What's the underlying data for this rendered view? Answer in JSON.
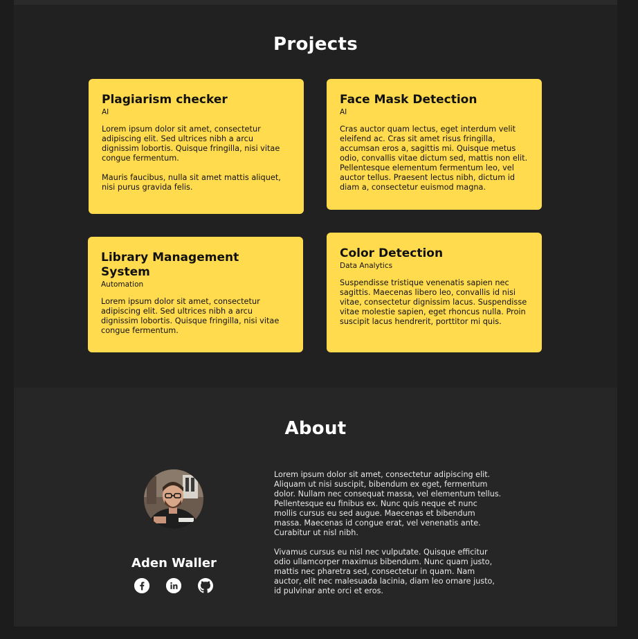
{
  "projects": {
    "title": "Projects",
    "cards": [
      {
        "title": "Plagiarism checker",
        "tag": "AI",
        "desc": "Lorem ipsum dolor sit amet, consectetur adipiscing elit. Sed ultrices nibh a arcu dignissim lobortis. Quisque fringilla, nisi vitae congue fermentum.\n\nMauris faucibus, nulla sit amet mattis aliquet, nisi purus gravida felis."
      },
      {
        "title": "Face Mask Detection",
        "tag": "AI",
        "desc": "Cras auctor quam lectus, eget interdum velit eleifend ac. Cras sit amet risus fringilla, accumsan eros a, sagittis mi. Quisque metus odio, convallis vitae dictum sed, mattis non elit. Pellentesque elementum fermentum leo, vel auctor tellus. Praesent lectus nibh, dictum id diam a, consectetur euismod magna."
      },
      {
        "title": "Library Management System",
        "tag": "Automation",
        "desc": "Lorem ipsum dolor sit amet, consectetur adipiscing elit. Sed ultrices nibh a arcu dignissim lobortis. Quisque fringilla, nisi vitae congue fermentum."
      },
      {
        "title": "Color Detection",
        "tag": "Data Analytics",
        "desc": "Suspendisse tristique venenatis sapien nec sagittis. Maecenas libero leo, convallis id nisi vitae, consectetur dignissim lacus. Suspendisse vitae molestie sapien, eget rhoncus nulla. Proin suscipit lacus hendrerit, porttitor mi quis."
      }
    ]
  },
  "about": {
    "title": "About",
    "name": "Aden Waller",
    "bio": "Lorem ipsum dolor sit amet, consectetur adipiscing elit. Aliquam ut nisi suscipit, bibendum ex eget, fermentum dolor. Nullam nec consequat massa, vel elementum tellus. Pellentesque eu finibus ex. Nunc quis neque et nunc mollis cursus eu sed augue. Maecenas et bibendum massa. Maecenas id congue erat, vel venenatis ante. Curabitur ut nisl nibh.\n\nVivamus cursus eu nisl nec vulputate. Quisque efficitur odio ullamcorper maximus bibendum. Nunc quam justo, mattis nec pharetra sed, consectetur in quam. Nam auctor, elit nec malesuada lacinia, diam leo ornare justo, id pulvinar ante orci et eros.",
    "social": [
      "facebook-icon",
      "linkedin-icon",
      "github-icon"
    ]
  },
  "colors": {
    "card": "#ffdb4d",
    "background": "#242424",
    "text": "#ffffff"
  }
}
